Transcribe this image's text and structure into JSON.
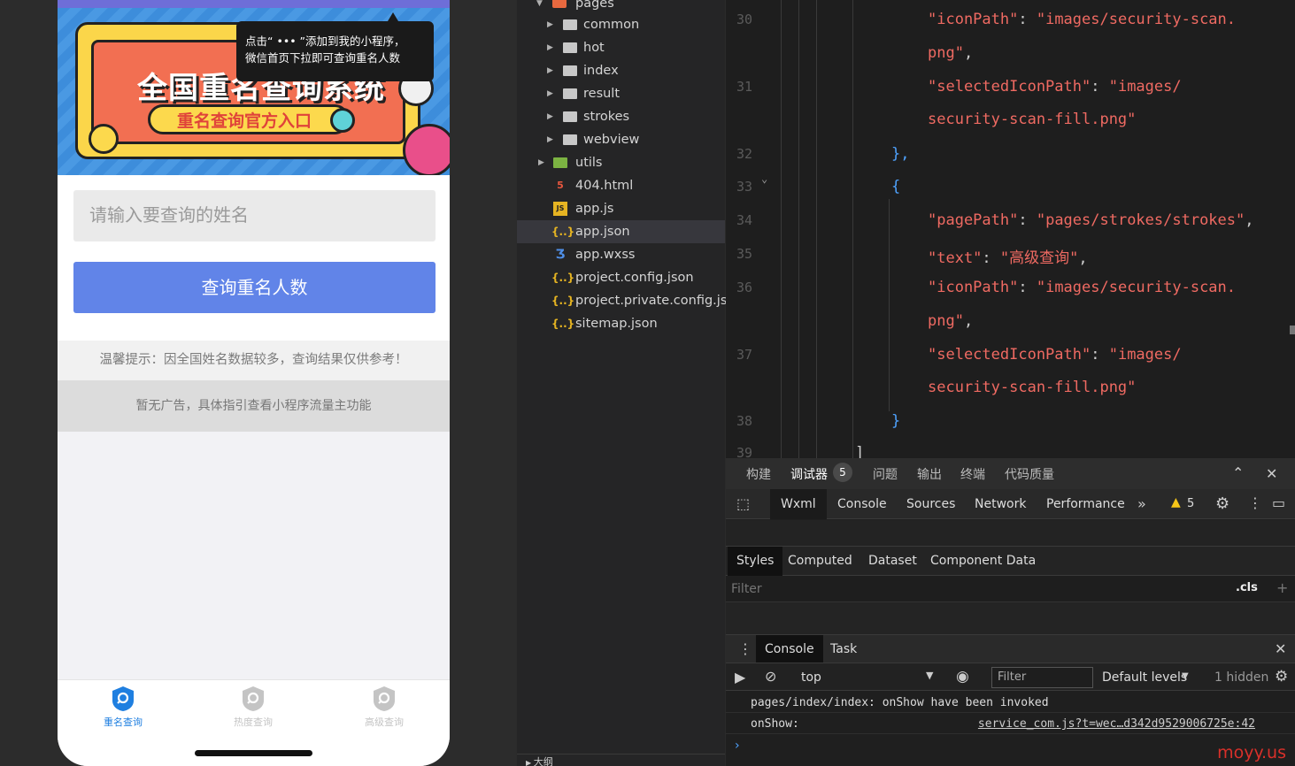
{
  "phone": {
    "banner": {
      "title": "全国重名查询系统",
      "pill_text": "重名查询官方入口",
      "tip_line1": "点击“ ••• ”添加到我的小程序，",
      "tip_line2": "微信首页下拉即可查询重名人数"
    },
    "input_placeholder": "请输入要查询的姓名",
    "query_button": "查询重名人数",
    "notice": "温馨提示：因全国姓名数据较多，查询结果仅供参考！",
    "ad": "暂无广告，具体指引查看小程序流量主功能",
    "tabs": [
      {
        "label": "重名查询",
        "active": true
      },
      {
        "label": "热度查询",
        "active": false
      },
      {
        "label": "高级查询",
        "active": false
      }
    ]
  },
  "tree": {
    "items": [
      {
        "label": "pages",
        "type": "folder-root"
      },
      {
        "label": "common",
        "type": "folder"
      },
      {
        "label": "hot",
        "type": "folder"
      },
      {
        "label": "index",
        "type": "folder"
      },
      {
        "label": "result",
        "type": "folder"
      },
      {
        "label": "strokes",
        "type": "folder"
      },
      {
        "label": "webview",
        "type": "folder"
      },
      {
        "label": "utils",
        "type": "folder-green"
      },
      {
        "label": "404.html",
        "type": "html"
      },
      {
        "label": "app.js",
        "type": "js"
      },
      {
        "label": "app.json",
        "type": "json",
        "selected": true
      },
      {
        "label": "app.wxss",
        "type": "wxss"
      },
      {
        "label": "project.config.json",
        "type": "json"
      },
      {
        "label": "project.private.config.js...",
        "type": "json"
      },
      {
        "label": "sitemap.json",
        "type": "json"
      }
    ],
    "bottom_label": "大纲"
  },
  "editor": {
    "line_numbers": [
      "30",
      "31",
      "32",
      "33",
      "34",
      "35",
      "36",
      "37",
      "38",
      "39"
    ],
    "lines": {
      "l30a_key": "\"iconPath\"",
      "l30a_val": "\"images/security-scan.",
      "l30b_val": "png\"",
      "l31a_key": "\"selectedIconPath\"",
      "l31a_val": "\"images/",
      "l31b_val": "security-scan-fill.png\"",
      "l32": "},",
      "l33": "{",
      "l34_key": "\"pagePath\"",
      "l34_val": "\"pages/strokes/strokes\"",
      "l35_key": "\"text\"",
      "l35_val": "\"高级查询\"",
      "l36a_key": "\"iconPath\"",
      "l36a_val": "\"images/security-scan.",
      "l36b_val": "png\"",
      "l37a_key": "\"selectedIconPath\"",
      "l37a_val": "\"images/",
      "l37b_val": "security-scan-fill.png\"",
      "l38": "}",
      "l39": "]"
    }
  },
  "devtools": {
    "top_tabs": [
      "构建",
      "调试器",
      "问题",
      "输出",
      "终端",
      "代码质量"
    ],
    "debugger_badge": "5",
    "panel_tabs": [
      "Wxml",
      "Console",
      "Sources",
      "Network",
      "Performance"
    ],
    "warning_count": "5",
    "style_tabs": [
      "Styles",
      "Computed",
      "Dataset",
      "Component Data"
    ],
    "filter_placeholder": "Filter",
    "cls_label": ".cls",
    "console_tabs": [
      "Console",
      "Task"
    ],
    "context": "top",
    "console_filter": "Filter",
    "levels": "Default levels",
    "hidden": "1 hidden",
    "logs": [
      {
        "text": "pages/index/index: onShow have been invoked",
        "link": ""
      },
      {
        "text": "onShow:",
        "link": "service_com.js?t=wec…d342d9529006725e:42"
      }
    ],
    "prompt": "›"
  },
  "watermark": "moyy.us",
  "colors": {
    "accent": "#6184e8",
    "tab_active": "#1f7fe0",
    "string": "#ef6a62"
  }
}
